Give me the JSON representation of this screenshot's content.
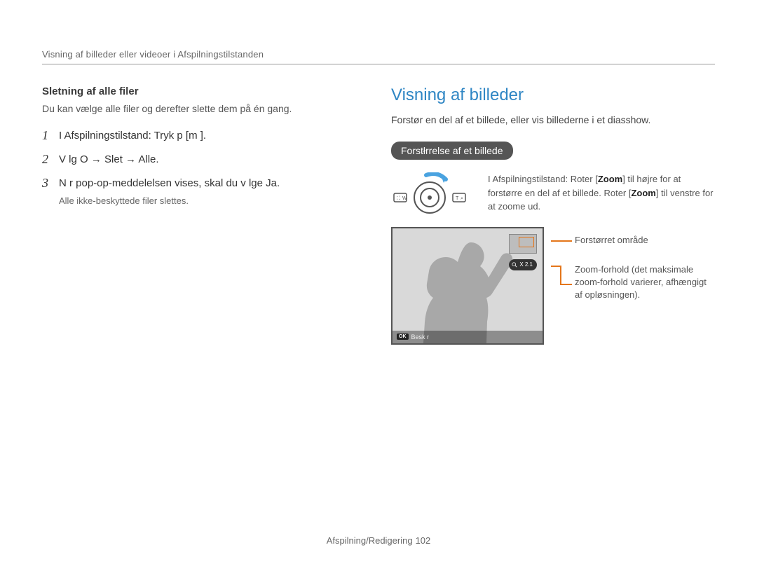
{
  "header": {
    "breadcrumb": "Visning af billeder eller videoer i Afspilningstilstanden"
  },
  "left": {
    "subhead": "Sletning af alle ﬁler",
    "body": "Du kan vælge alle ﬁler og derefter slette dem på én gang.",
    "steps": [
      {
        "num": "1",
        "text": "I Afspilningstilstand: Tryk p  [m     ]."
      },
      {
        "num": "2",
        "prefix": "V lg  O    ",
        "arrow1": "→",
        "mid1": " Slet ",
        "arrow2": "→",
        "mid2": " Alle.",
        "text_full": "V lg  O    → Slet → Alle."
      },
      {
        "num": "3",
        "text": "N r pop-op-meddelelsen vises, skal du v lge Ja.",
        "note": "Alle ikke-beskyttede ﬁler slettes."
      }
    ]
  },
  "right": {
    "title": "Visning af billeder",
    "intro": "Forstør en del af et billede, eller vis billederne i et diasshow.",
    "pill": "Forstłrrelse af et billede",
    "dial": {
      "left_icon": "W",
      "right_icon": "T",
      "left_glyph": "⛶",
      "right_glyph": "🔍"
    },
    "zoom_desc_1": "I Afspilningstilstand: Roter [",
    "zoom_desc_zoom": "Zoom",
    "zoom_desc_2": "] til højre for at forstørre en del af et billede. Roter [",
    "zoom_desc_3": "] til venstre for at zoome ud.",
    "ratio": "X 2.1",
    "ok_label": "OK",
    "ok_text": "Besk r",
    "callout1": "Forstørret område",
    "callout2": "Zoom-forhold (det maksimale zoom-forhold varierer, afhængigt af opløsningen)."
  },
  "footer": {
    "section": "Afspilning/Redigering",
    "page": "102"
  }
}
